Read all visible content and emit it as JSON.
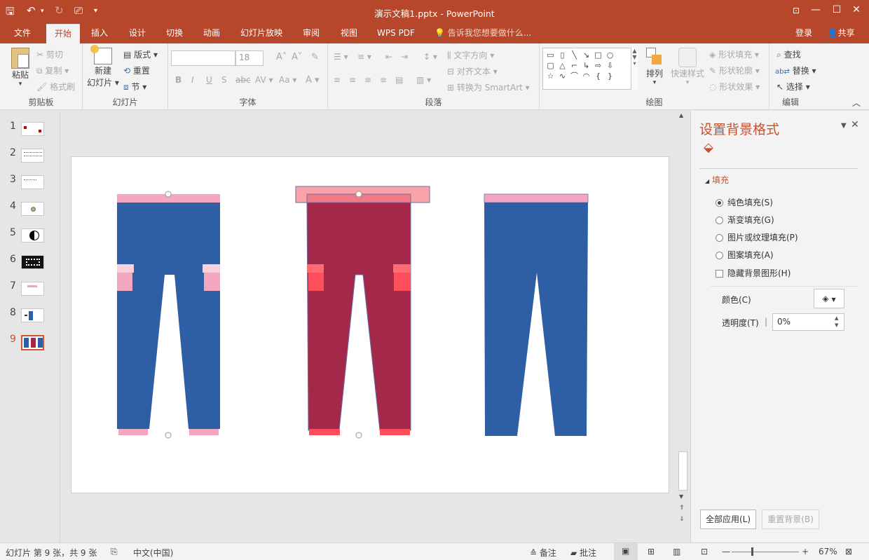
{
  "window": {
    "title": "演示文稿1.pptx - PowerPoint"
  },
  "tabs": [
    "文件",
    "开始",
    "插入",
    "设计",
    "切换",
    "动画",
    "幻灯片放映",
    "审阅",
    "视图",
    "WPS PDF"
  ],
  "active_tab": "开始",
  "tell_me": "告诉我您想要做什么...",
  "login": "登录",
  "share": "共享",
  "ribbon": {
    "clipboard": {
      "label": "剪贴板",
      "paste": "粘贴",
      "cut": "剪切",
      "copy": "复制",
      "format_painter": "格式刷"
    },
    "slides": {
      "label": "幻灯片",
      "new_slide_1": "新建",
      "new_slide_2": "幻灯片",
      "layout": "版式",
      "reset": "重置",
      "section": "节"
    },
    "font": {
      "label": "字体",
      "font_name": "",
      "font_size": "18"
    },
    "paragraph": {
      "label": "段落",
      "text_direction": "文字方向",
      "align_text": "对齐文本",
      "convert_smartart": "转换为 SmartArt"
    },
    "drawing": {
      "label": "绘图",
      "arrange": "排列",
      "quick_styles": "快速样式",
      "shape_fill": "形状填充",
      "shape_outline": "形状轮廓",
      "shape_effects": "形状效果"
    },
    "editing": {
      "label": "编辑",
      "find": "查找",
      "replace": "替换",
      "select": "选择"
    }
  },
  "thumbnails": [
    "1",
    "2",
    "3",
    "4",
    "5",
    "6",
    "7",
    "8",
    "9"
  ],
  "selected_slide": "9",
  "pane": {
    "title": "设置背景格式",
    "section": "填充",
    "options": [
      "纯色填充(S)",
      "渐变填充(G)",
      "图片或纹理填充(P)",
      "图案填充(A)"
    ],
    "hide_graphics": "隐藏背景图形(H)",
    "color_label": "颜色(C)",
    "transparency_label": "透明度(T)",
    "transparency_value": "0%",
    "apply_all": "全部应用(L)",
    "reset_bg": "重置背景(B)"
  },
  "status": {
    "slide_info": "幻灯片 第 9 张，共 9 张",
    "language": "中文(中国)",
    "notes": "备注",
    "comments": "批注",
    "zoom": "67%"
  },
  "colors": {
    "accent": "#b7472a",
    "pants_blue": "#2e5fa4",
    "pants_red": "#a4284a",
    "pink": "#f4a5c0",
    "coral": "#ff4f5a"
  }
}
